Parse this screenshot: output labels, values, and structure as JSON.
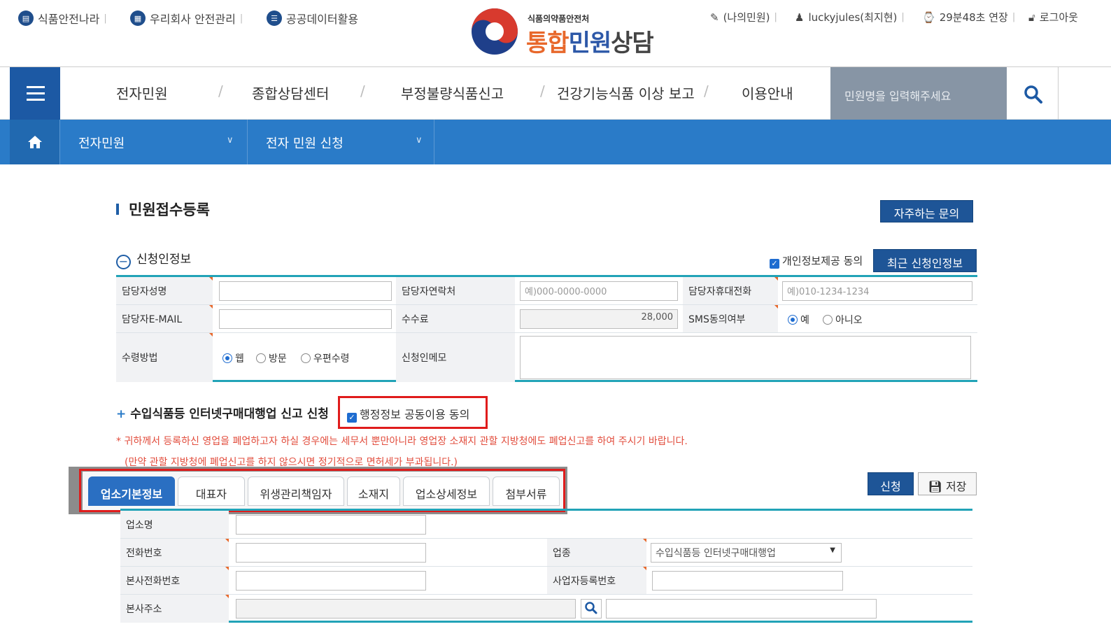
{
  "util_left": [
    {
      "icon": "document-icon",
      "label": "식품안전나라"
    },
    {
      "icon": "building-icon",
      "label": "우리회사 안전관리"
    },
    {
      "icon": "data-icon",
      "label": "공공데이터활용"
    }
  ],
  "logo": {
    "sub": "식품의약품안전처",
    "main_a": "통합",
    "main_b": "민원",
    "main_c": "상담"
  },
  "util_right": {
    "my_minwon": "(나의민원)",
    "user": "luckyjules(최지현)",
    "timer": "29분48초 연장",
    "logout": "로그아웃"
  },
  "nav": {
    "items": [
      "전자민원",
      "종합상담센터",
      "부정불량식품신고",
      "건강기능식품 이상 보고",
      "이용안내"
    ],
    "search_placeholder": "민원명을 입력해주세요"
  },
  "breadcrumb": {
    "level1": "전자민원",
    "level2": "전자 민원 신청"
  },
  "page": {
    "title": "민원접수등록",
    "faq_button": "자주하는 문의"
  },
  "applicant": {
    "heading": "신청인정보",
    "consent_label": "개인정보제공 동의",
    "recent_button": "최근 신청인정보",
    "labels": {
      "name": "담당자성명",
      "contact": "담당자연락처",
      "mobile": "담당자휴대전화",
      "email": "담당자E-MAIL",
      "fee": "수수료",
      "sms": "SMS동의여부",
      "receive": "수령방법",
      "memo": "신청인메모"
    },
    "contact_placeholder": "예)000-0000-0000",
    "mobile_placeholder": "예)010-1234-1234",
    "fee_value": "28,000",
    "sms_options": [
      "예",
      "아니오"
    ],
    "sms_selected": "예",
    "receive_options": [
      "웹",
      "방문",
      "우편수령"
    ],
    "receive_selected": "웹"
  },
  "report": {
    "heading": "수입식품등 인터넷구매대행업 신고 신청",
    "admin_consent": "행정정보 공동이용 동의",
    "note1": "* 귀하께서 등록하신 영업을 폐업하고자 하실 경우에는 세무서 뿐만아니라 영업장 소재지 관할 지방청에도 폐업신고를 하여 주시기 바랍니다.",
    "note2": "(만약 관할 지방청에 폐업신고를 하지 않으시면 정기적으로 면허세가 부과됩니다.)",
    "tabs": [
      "업소기본정보",
      "대표자",
      "위생관리책임자",
      "소재지",
      "업소상세정보",
      "첨부서류"
    ],
    "apply_button": "신청",
    "save_button": "저장"
  },
  "business": {
    "labels": {
      "name": "업소명",
      "phone": "전화번호",
      "type": "업종",
      "hq_phone": "본사전화번호",
      "reg_no": "사업자등록번호",
      "hq_address": "본사주소"
    },
    "type_value": "수입식품등 인터넷구매대행업"
  },
  "colors": {
    "nav_blue": "#1c59a4",
    "crumb_blue": "#2a7bc8",
    "teal": "#22a3b7",
    "highlight_red": "#e01c1c",
    "note_red": "#e24d3d"
  }
}
